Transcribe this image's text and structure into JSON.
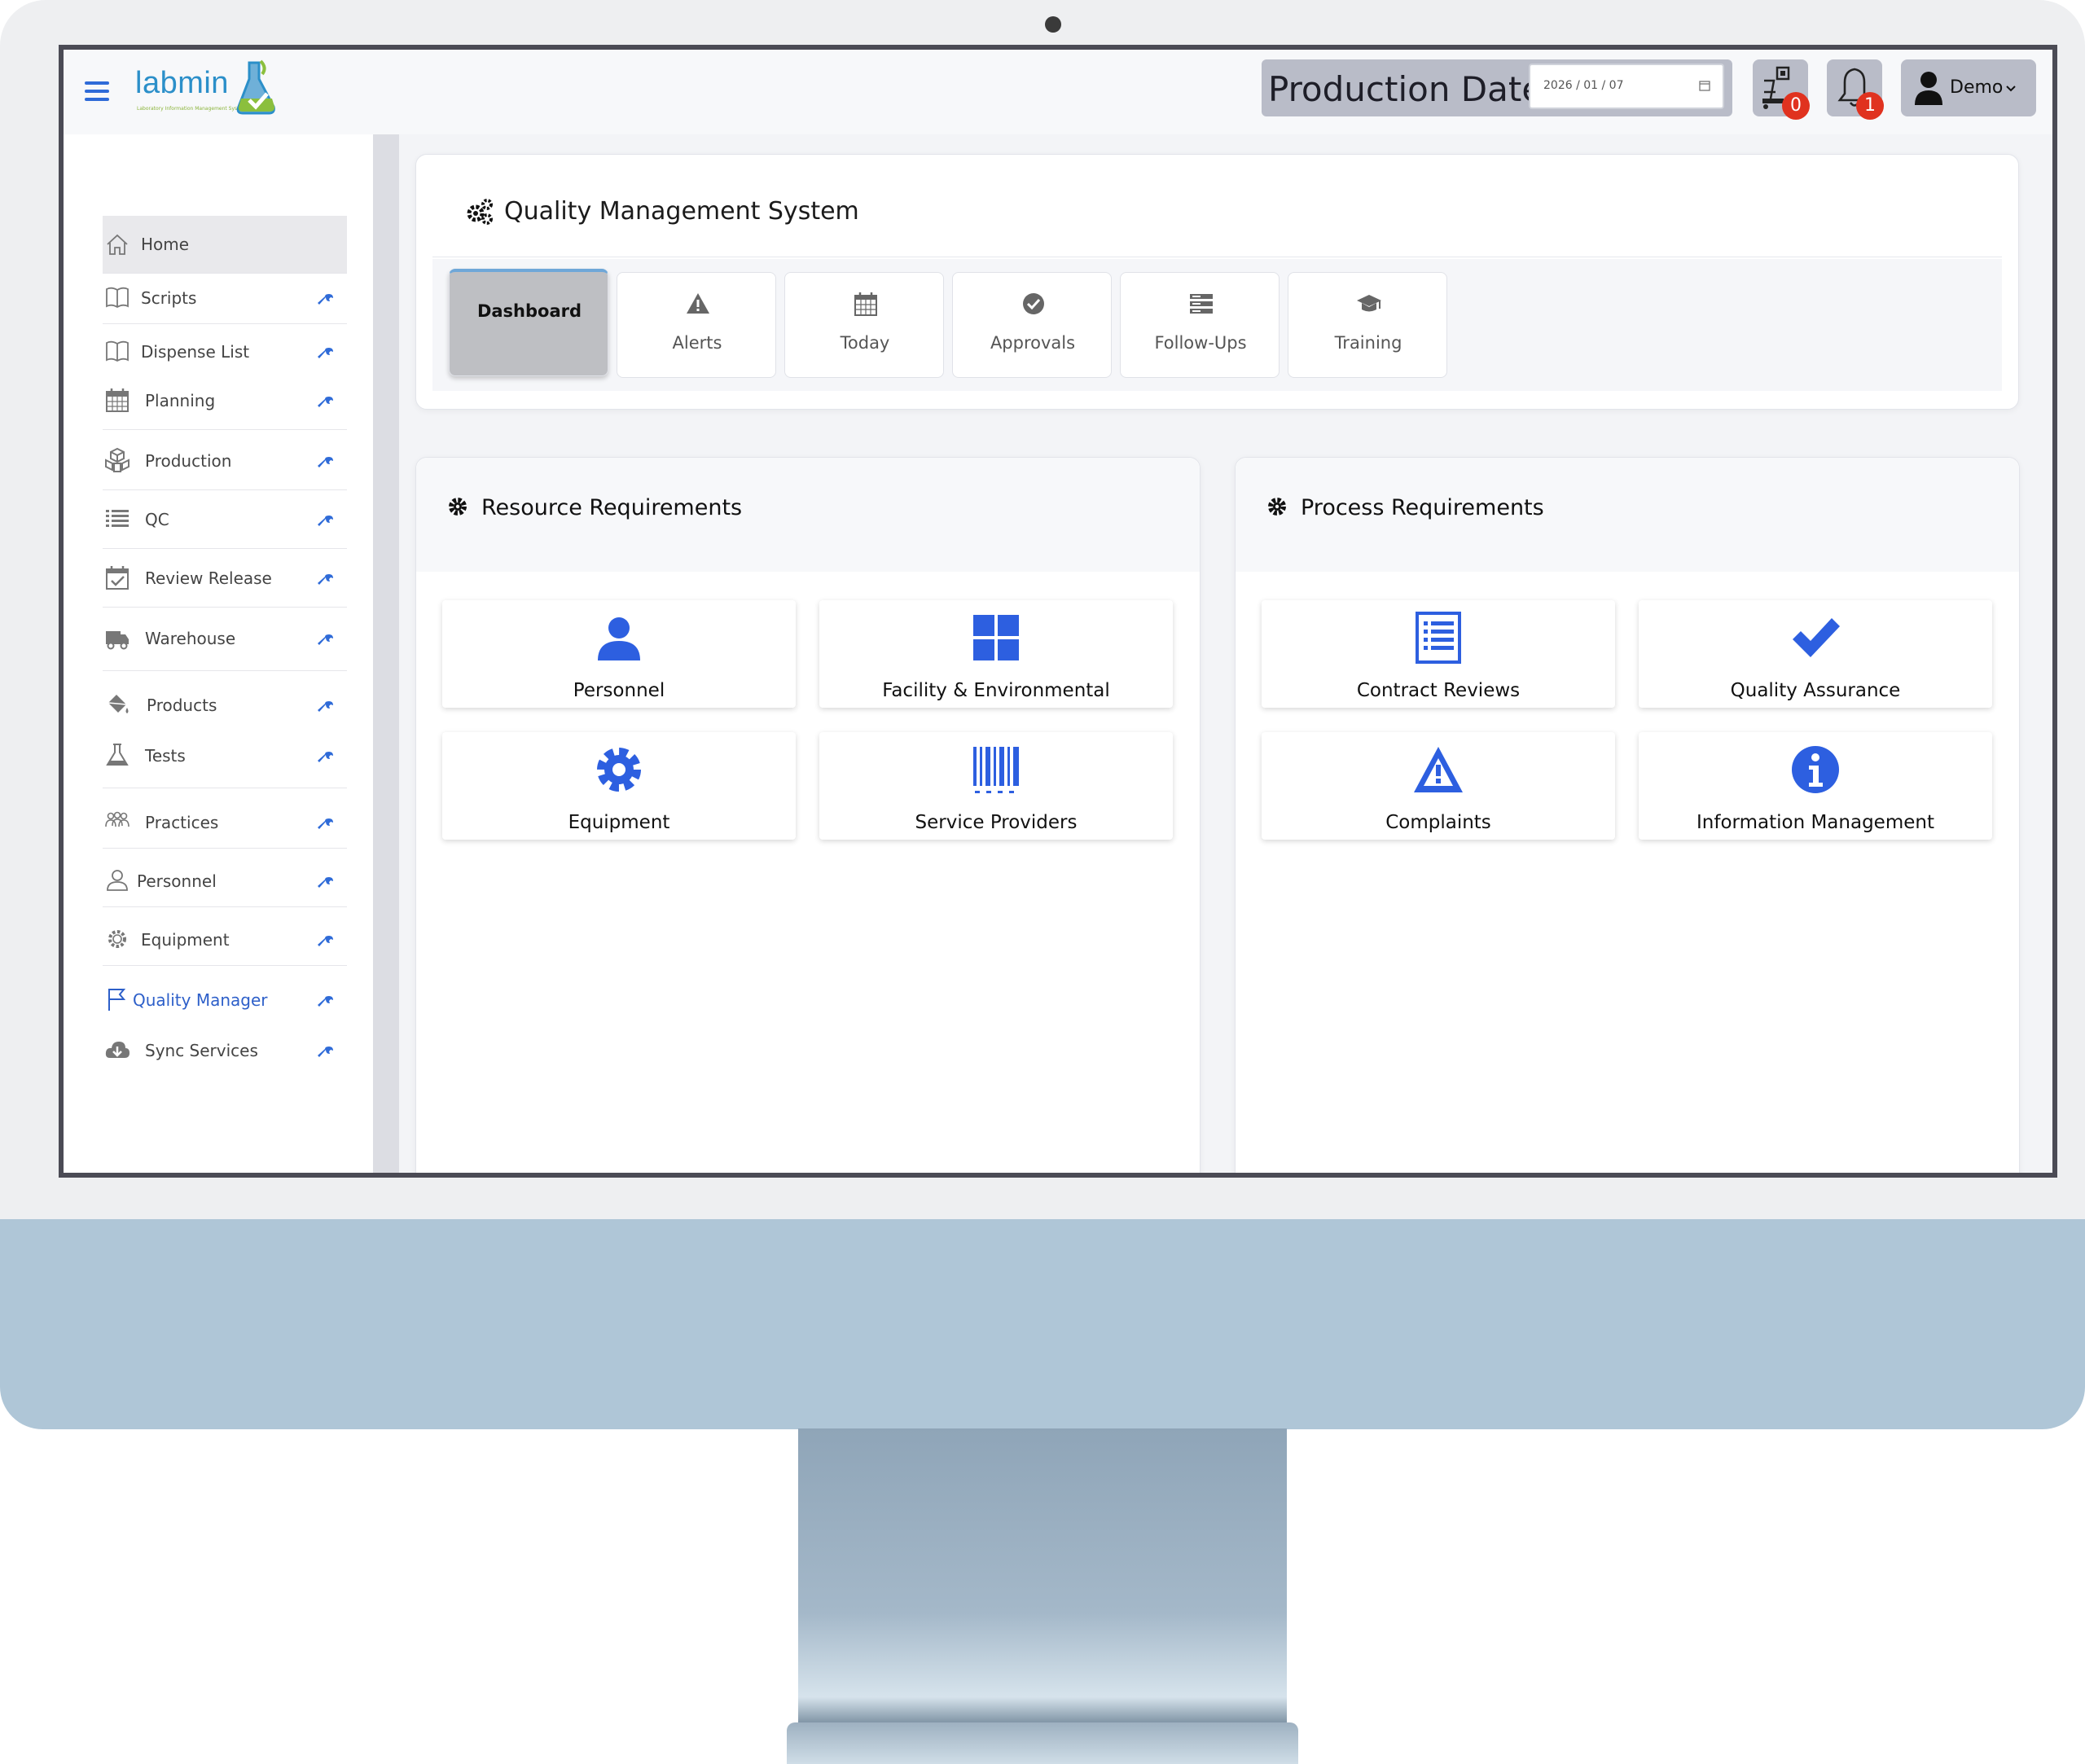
{
  "app": {
    "logo_text": "labmin",
    "logo_tagline": "Laboratory Information Management System"
  },
  "topbar": {
    "production_date_label": "Production Date",
    "production_date_value": "2026 / 01 / 07",
    "dispatch_count": "0",
    "notification_count": "1",
    "user_name": "Demo"
  },
  "sidebar": {
    "items": [
      {
        "label": "Home"
      },
      {
        "label": "Scripts"
      },
      {
        "label": "Dispense List"
      },
      {
        "label": "Planning"
      },
      {
        "label": "Production"
      },
      {
        "label": "QC"
      },
      {
        "label": "Review Release"
      },
      {
        "label": "Warehouse"
      },
      {
        "label": "Products"
      },
      {
        "label": "Tests"
      },
      {
        "label": "Practices"
      },
      {
        "label": "Personnel"
      },
      {
        "label": "Equipment"
      },
      {
        "label": "Quality Manager"
      },
      {
        "label": "Sync Services"
      }
    ],
    "active_color": "#2d5fc9"
  },
  "qms": {
    "title": "Quality Management System",
    "tabs": [
      {
        "label": "Dashboard",
        "icon": "none"
      },
      {
        "label": "Alerts",
        "icon": "warning-icon"
      },
      {
        "label": "Today",
        "icon": "calendar-icon"
      },
      {
        "label": "Approvals",
        "icon": "check-circle-icon"
      },
      {
        "label": "Follow-Ups",
        "icon": "server-icon"
      },
      {
        "label": "Training",
        "icon": "graduation-cap-icon"
      }
    ]
  },
  "resource": {
    "title": "Resource Requirements",
    "tiles": [
      {
        "label": "Personnel",
        "icon": "user-icon"
      },
      {
        "label": "Facility & Environmental",
        "icon": "grid-icon"
      },
      {
        "label": "Equipment",
        "icon": "gear-icon"
      },
      {
        "label": "Service Providers",
        "icon": "barcode-icon"
      }
    ]
  },
  "process": {
    "title": "Process Requirements",
    "tiles": [
      {
        "label": "Contract Reviews",
        "icon": "list-document-icon"
      },
      {
        "label": "Quality Assurance",
        "icon": "checkmark-icon"
      },
      {
        "label": "Complaints",
        "icon": "warning-icon"
      },
      {
        "label": "Information Management",
        "icon": "info-icon"
      }
    ]
  },
  "colors": {
    "accent_blue": "#2d5fe0",
    "badge_red": "#e0321f",
    "chin": "#afc6d7"
  }
}
